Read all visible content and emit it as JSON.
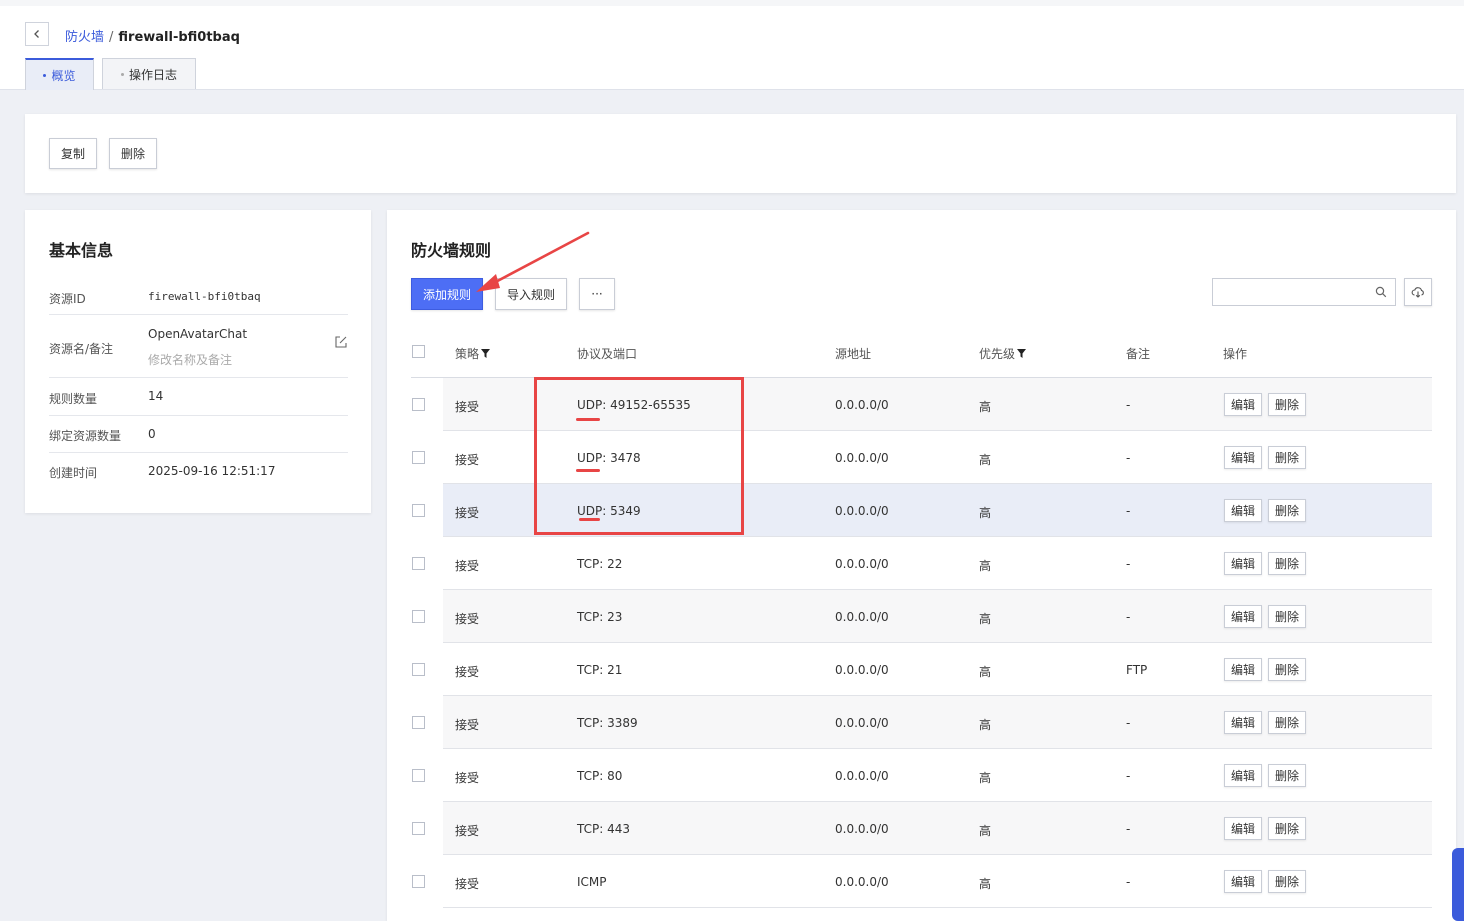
{
  "breadcrumb": {
    "parent": "防火墙",
    "separator": "/",
    "current": "firewall-bfi0tbaq"
  },
  "tabs": [
    {
      "label": "概览",
      "active": true
    },
    {
      "label": "操作日志",
      "active": false
    }
  ],
  "actions": {
    "copy": "复制",
    "delete": "删除"
  },
  "info": {
    "title": "基本信息",
    "rows": [
      {
        "label": "资源ID",
        "value": "firewall-bfi0tbaq"
      },
      {
        "label": "资源名/备注",
        "value": "OpenAvatarChat",
        "sub": "修改名称及备注"
      },
      {
        "label": "规则数量",
        "value": "14"
      },
      {
        "label": "绑定资源数量",
        "value": "0"
      },
      {
        "label": "创建时间",
        "value": "2025-09-16 12:51:17"
      }
    ]
  },
  "rules": {
    "title": "防火墙规则",
    "add_button": "添加规则",
    "import_button": "导入规则",
    "more_button": "···",
    "search_placeholder": "",
    "headers": {
      "policy": "策略",
      "protocol": "协议及端口",
      "source": "源地址",
      "priority": "优先级",
      "note": "备注",
      "ops": "操作"
    },
    "row_actions": {
      "edit": "编辑",
      "delete": "删除"
    },
    "rows": [
      {
        "policy": "接受",
        "protocol": "UDP: 49152-65535",
        "source": "0.0.0.0/0",
        "priority": "高",
        "note": "-"
      },
      {
        "policy": "接受",
        "protocol": "UDP: 3478",
        "source": "0.0.0.0/0",
        "priority": "高",
        "note": "-"
      },
      {
        "policy": "接受",
        "protocol": "UDP: 5349",
        "source": "0.0.0.0/0",
        "priority": "高",
        "note": "-"
      },
      {
        "policy": "接受",
        "protocol": "TCP: 22",
        "source": "0.0.0.0/0",
        "priority": "高",
        "note": "-"
      },
      {
        "policy": "接受",
        "protocol": "TCP: 23",
        "source": "0.0.0.0/0",
        "priority": "高",
        "note": "-"
      },
      {
        "policy": "接受",
        "protocol": "TCP: 21",
        "source": "0.0.0.0/0",
        "priority": "高",
        "note": "FTP"
      },
      {
        "policy": "接受",
        "protocol": "TCP: 3389",
        "source": "0.0.0.0/0",
        "priority": "高",
        "note": "-"
      },
      {
        "policy": "接受",
        "protocol": "TCP: 80",
        "source": "0.0.0.0/0",
        "priority": "高",
        "note": "-"
      },
      {
        "policy": "接受",
        "protocol": "TCP: 443",
        "source": "0.0.0.0/0",
        "priority": "高",
        "note": "-"
      },
      {
        "policy": "接受",
        "protocol": "ICMP",
        "source": "0.0.0.0/0",
        "priority": "高",
        "note": "-"
      }
    ]
  },
  "colors": {
    "accent": "#3b5bdb",
    "primary_button": "#4d6ef5",
    "annotation": "#e84545",
    "highlight_row": "#e9edf7"
  }
}
